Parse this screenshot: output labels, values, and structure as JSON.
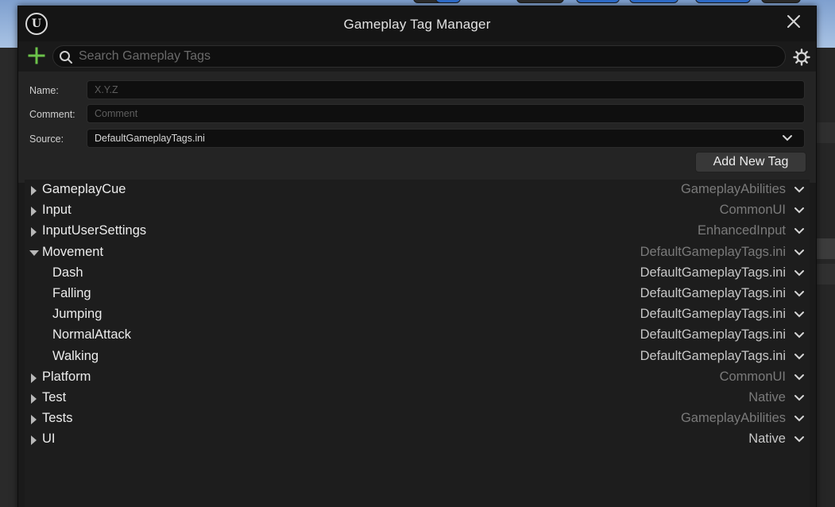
{
  "window": {
    "title": "Gameplay Tag Manager"
  },
  "toolbar": {
    "search_placeholder": "Search Gameplay Tags"
  },
  "form": {
    "name_label": "Name:",
    "name_placeholder": "X.Y.Z",
    "comment_label": "Comment:",
    "comment_placeholder": "Comment",
    "source_label": "Source:",
    "source_value": "DefaultGameplayTags.ini",
    "add_button_label": "Add New Tag"
  },
  "tags": [
    {
      "name": "GameplayCue",
      "source": "GameplayAbilities",
      "expanded": false,
      "child": false,
      "source_bright": false
    },
    {
      "name": "Input",
      "source": "CommonUI",
      "expanded": false,
      "child": false,
      "source_bright": false
    },
    {
      "name": "InputUserSettings",
      "source": "EnhancedInput",
      "expanded": false,
      "child": false,
      "source_bright": false
    },
    {
      "name": "Movement",
      "source": "DefaultGameplayTags.ini",
      "expanded": true,
      "child": false,
      "source_bright": false
    },
    {
      "name": "Dash",
      "source": "DefaultGameplayTags.ini",
      "expanded": false,
      "child": true,
      "source_bright": true
    },
    {
      "name": "Falling",
      "source": "DefaultGameplayTags.ini",
      "expanded": false,
      "child": true,
      "source_bright": true
    },
    {
      "name": "Jumping",
      "source": "DefaultGameplayTags.ini",
      "expanded": false,
      "child": true,
      "source_bright": true
    },
    {
      "name": "NormalAttack",
      "source": "DefaultGameplayTags.ini",
      "expanded": false,
      "child": true,
      "source_bright": true
    },
    {
      "name": "Walking",
      "source": "DefaultGameplayTags.ini",
      "expanded": false,
      "child": true,
      "source_bright": true
    },
    {
      "name": "Platform",
      "source": "CommonUI",
      "expanded": false,
      "child": false,
      "source_bright": false
    },
    {
      "name": "Test",
      "source": "Native",
      "expanded": false,
      "child": false,
      "source_bright": false
    },
    {
      "name": "Tests",
      "source": "GameplayAbilities",
      "expanded": false,
      "child": false,
      "source_bright": false
    },
    {
      "name": "UI",
      "source": "Native",
      "expanded": false,
      "child": false,
      "source_bright": true
    }
  ],
  "colors": {
    "accent_add": "#6cc24a",
    "background": "#1a1a1a",
    "text": "#ececec",
    "dim_text": "#7a7a7a"
  },
  "icons": {
    "logo": "unreal-logo-icon",
    "close": "close-icon",
    "add": "plus-icon",
    "search": "search-icon",
    "settings": "gear-icon",
    "collapsed": "triangle-right-icon",
    "expanded": "triangle-down-icon",
    "dropdown": "chevron-down-icon"
  }
}
